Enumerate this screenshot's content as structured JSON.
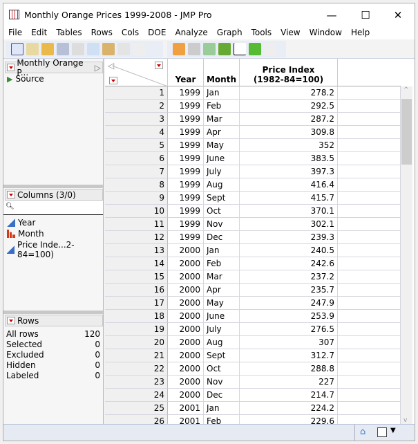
{
  "window": {
    "title": "Monthly Orange Prices 1999-2008 - JMP Pro",
    "minimize": "—",
    "maximize": "☐",
    "close": "✕"
  },
  "menu": [
    "File",
    "Edit",
    "Tables",
    "Rows",
    "Cols",
    "DOE",
    "Analyze",
    "Graph",
    "Tools",
    "View",
    "Window",
    "Help"
  ],
  "table_panel": {
    "title": "Monthly Orange P...",
    "source": "Source"
  },
  "columns_panel": {
    "title": "Columns (3/0)",
    "search_placeholder": "",
    "items": [
      {
        "name": "Year",
        "type": "continuous"
      },
      {
        "name": "Month",
        "type": "nominal"
      },
      {
        "name": "Price Inde...2-84=100)",
        "type": "continuous"
      }
    ]
  },
  "rows_panel": {
    "title": "Rows",
    "items": [
      {
        "label": "All rows",
        "value": "120"
      },
      {
        "label": "Selected",
        "value": "0"
      },
      {
        "label": "Excluded",
        "value": "0"
      },
      {
        "label": "Hidden",
        "value": "0"
      },
      {
        "label": "Labeled",
        "value": "0"
      }
    ]
  },
  "table": {
    "headers": [
      "Year",
      "Month",
      "Price Index (1982-84=100)"
    ],
    "rows": [
      [
        "1",
        "1999",
        "Jan",
        "278.2"
      ],
      [
        "2",
        "1999",
        "Feb",
        "292.5"
      ],
      [
        "3",
        "1999",
        "Mar",
        "287.2"
      ],
      [
        "4",
        "1999",
        "Apr",
        "309.8"
      ],
      [
        "5",
        "1999",
        "May",
        "352"
      ],
      [
        "6",
        "1999",
        "June",
        "383.5"
      ],
      [
        "7",
        "1999",
        "July",
        "397.3"
      ],
      [
        "8",
        "1999",
        "Aug",
        "416.4"
      ],
      [
        "9",
        "1999",
        "Sept",
        "415.7"
      ],
      [
        "10",
        "1999",
        "Oct",
        "370.1"
      ],
      [
        "11",
        "1999",
        "Nov",
        "302.1"
      ],
      [
        "12",
        "1999",
        "Dec",
        "239.3"
      ],
      [
        "13",
        "2000",
        "Jan",
        "240.5"
      ],
      [
        "14",
        "2000",
        "Feb",
        "242.6"
      ],
      [
        "15",
        "2000",
        "Mar",
        "237.2"
      ],
      [
        "16",
        "2000",
        "Apr",
        "235.7"
      ],
      [
        "17",
        "2000",
        "May",
        "247.9"
      ],
      [
        "18",
        "2000",
        "June",
        "253.9"
      ],
      [
        "19",
        "2000",
        "July",
        "276.5"
      ],
      [
        "20",
        "2000",
        "Aug",
        "307"
      ],
      [
        "21",
        "2000",
        "Sept",
        "312.7"
      ],
      [
        "22",
        "2000",
        "Oct",
        "288.8"
      ],
      [
        "23",
        "2000",
        "Nov",
        "227"
      ],
      [
        "24",
        "2000",
        "Dec",
        "214.7"
      ],
      [
        "25",
        "2001",
        "Jan",
        "224.2"
      ],
      [
        "26",
        "2001",
        "Feb",
        "229.6"
      ]
    ]
  },
  "colors": {
    "accent_red": "#cc0000",
    "continuous_blue": "#3a6fc7",
    "nominal_red": "#d23a1a"
  }
}
